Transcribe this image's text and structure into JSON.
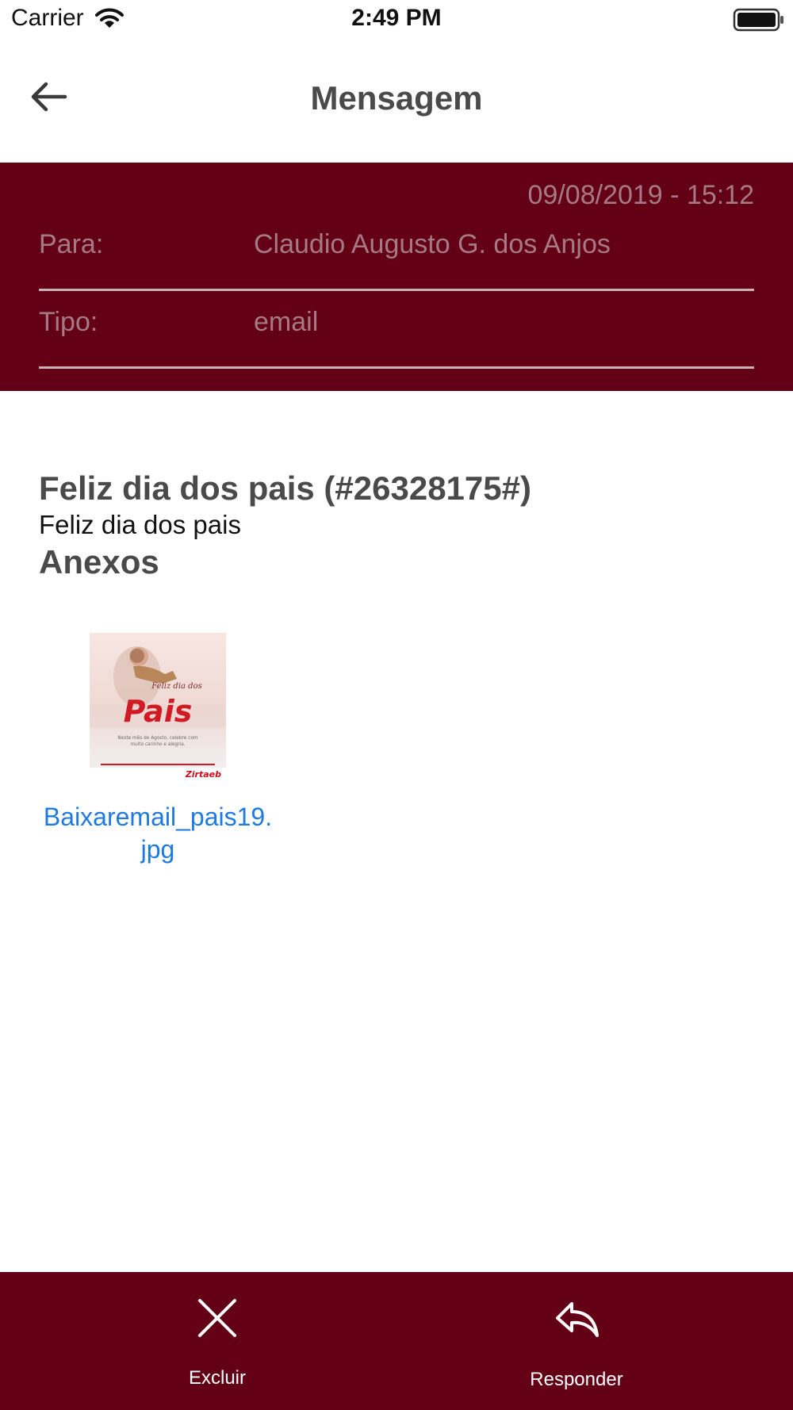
{
  "status_bar": {
    "carrier": "Carrier",
    "time": "2:49 PM"
  },
  "nav": {
    "title": "Mensagem",
    "back_icon": "arrow-left-icon"
  },
  "message": {
    "date": "09/08/2019 - 15:12",
    "fields": {
      "to_label": "Para:",
      "to_value": "Claudio Augusto G. dos Anjos",
      "type_label": "Tipo:",
      "type_value": "email"
    },
    "subject": "Feliz dia dos pais (#26328175#)",
    "body": "Feliz dia dos pais",
    "attachments_heading": "Anexos",
    "attachments": [
      {
        "filename_line1": "Baixaremail_pais19.",
        "filename_line2": "jpg",
        "thumbnail": {
          "title_script": "Feliz dia dos",
          "title_big": "Pais",
          "caption_line1": "Neste mês de Agosto, celebre com",
          "caption_line2": "muito carinho e alegria.",
          "brand": "Zirtaeb"
        }
      }
    ]
  },
  "bottom_bar": {
    "delete_label": "Excluir",
    "delete_icon": "close-icon",
    "reply_label": "Responder",
    "reply_icon": "reply-icon"
  },
  "colors": {
    "brand_dark_red": "#640015",
    "link_blue": "#1f7ae0",
    "header_text": "#a67a84"
  }
}
